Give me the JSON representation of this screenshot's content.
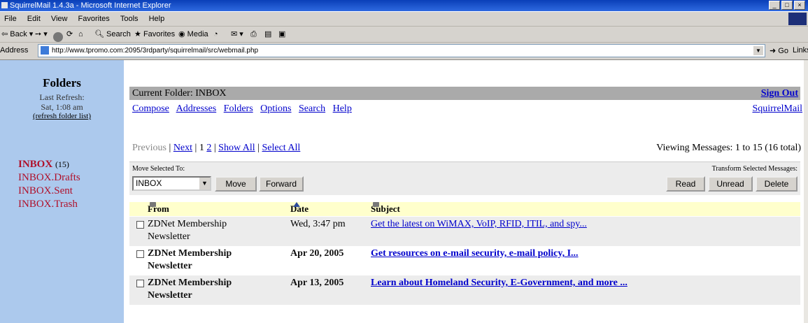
{
  "window": {
    "title": "SquirrelMail 1.4.3a - Microsoft Internet Explorer"
  },
  "menu": [
    "File",
    "Edit",
    "View",
    "Favorites",
    "Tools",
    "Help"
  ],
  "toolbar": {
    "back": "Back",
    "search": "Search",
    "favorites": "Favorites",
    "media": "Media"
  },
  "address": {
    "label": "Address",
    "url": "http://www.tpromo.com:2095/3rdparty/squirrelmail/src/webmail.php",
    "go": "Go",
    "links": "Links"
  },
  "sidebar": {
    "title": "Folders",
    "last_refresh_label": "Last Refresh:",
    "last_refresh_value": "Sat, 1:08 am",
    "refresh_link": "(refresh folder list)",
    "folders": [
      {
        "name": "INBOX",
        "count": "(15)",
        "bold": true
      },
      {
        "name": "INBOX.Drafts"
      },
      {
        "name": "INBOX.Sent"
      },
      {
        "name": "INBOX.Trash"
      }
    ]
  },
  "header": {
    "current_folder": "Current Folder: INBOX",
    "sign_out": "Sign Out"
  },
  "nav": [
    "Compose",
    "Addresses",
    "Folders",
    "Options",
    "Search",
    "Help"
  ],
  "brand": "SquirrelMail",
  "pager": {
    "previous": "Previous",
    "next": "Next",
    "page1": "1",
    "page2": "2",
    "show_all": "Show All",
    "select_all": "Select All",
    "viewing": "Viewing Messages: 1 to 15 (16 total)"
  },
  "actions": {
    "move_label": "Move Selected To:",
    "transform_label": "Transform Selected Messages:",
    "target_folder": "INBOX",
    "move": "Move",
    "forward": "Forward",
    "read": "Read",
    "unread": "Unread",
    "delete": "Delete"
  },
  "columns": {
    "from": "From",
    "date": "Date",
    "subject": "Subject"
  },
  "messages": [
    {
      "from1": "ZDNet Membership",
      "from2": "Newsletter",
      "date": "Wed, 3:47 pm",
      "subject": "Get the latest on WiMAX, VoIP, RFID, ITIL, and spy...",
      "unread": false
    },
    {
      "from1": "ZDNet Membership",
      "from2": "Newsletter",
      "date": "Apr 20, 2005",
      "subject": "Get resources on e-mail security, e-mail policy, I...",
      "unread": true
    },
    {
      "from1": "ZDNet Membership",
      "from2": "Newsletter",
      "date": "Apr 13, 2005",
      "subject": "Learn about Homeland Security, E-Government, and more ...",
      "unread": true
    }
  ],
  "colors": {
    "sidebar_bg": "#acc9ed",
    "header_bar": "#aaaaaa",
    "column_header_bg": "#ffffcc",
    "row_alt_bg": "#ececec",
    "link": "#0000cc",
    "folder_text": "#b0102a"
  }
}
